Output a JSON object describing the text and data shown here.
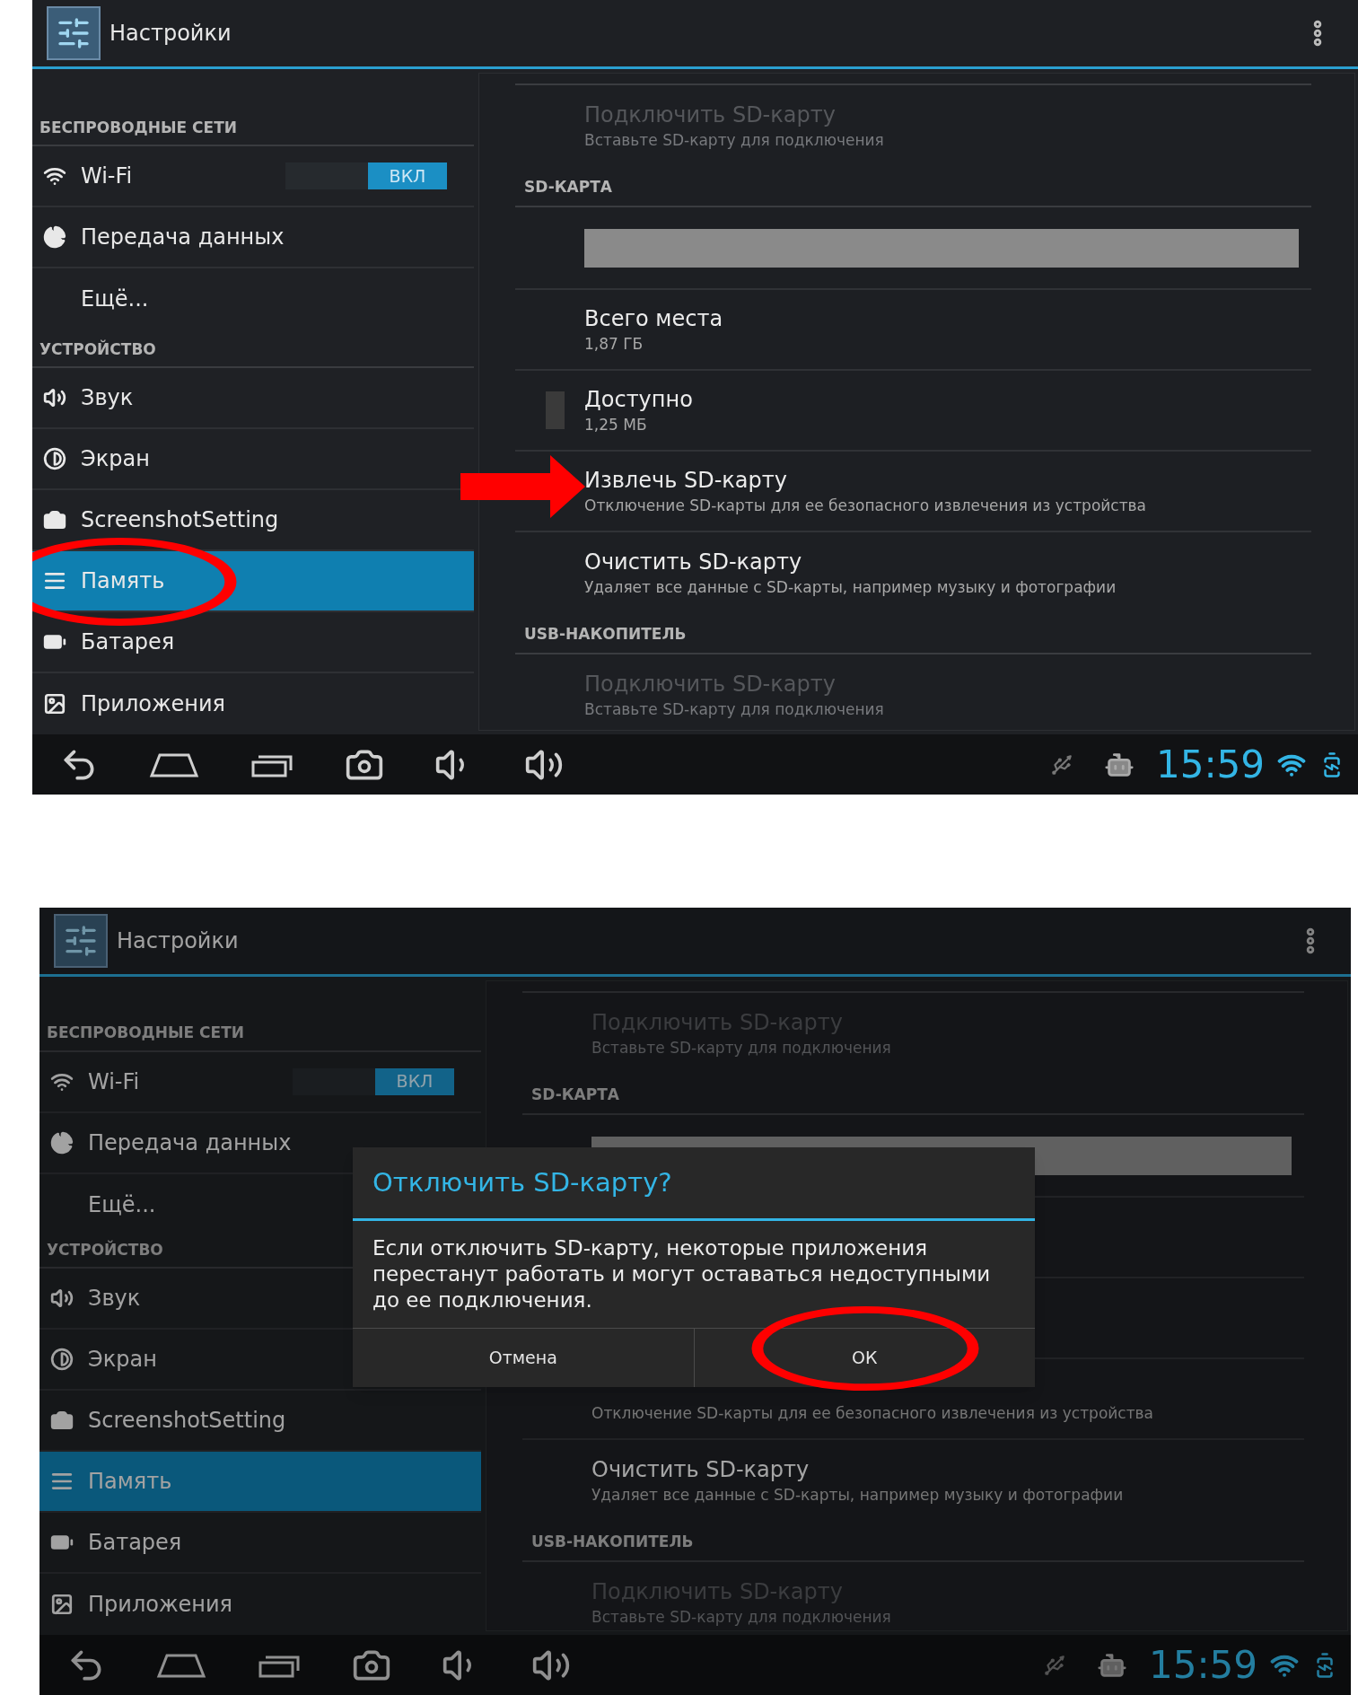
{
  "screens": [
    {
      "title": "Настройки",
      "sidebar": [
        {
          "kind": "header",
          "label": "БЕСПРОВОДНЫЕ СЕТИ"
        },
        {
          "kind": "item",
          "label": "Wi-Fi",
          "selected": false,
          "toggle": {
            "label": "ВКЛ",
            "on": true
          }
        },
        {
          "kind": "item",
          "label": "Передача данных",
          "selected": false
        },
        {
          "kind": "item",
          "label": "Ещё...",
          "selected": false
        },
        {
          "kind": "header",
          "label": "УСТРОЙСТВО"
        },
        {
          "kind": "item",
          "label": "Звук",
          "selected": false
        },
        {
          "kind": "item",
          "label": "Экран",
          "selected": false
        },
        {
          "kind": "item",
          "label": "ScreenshotSetting",
          "selected": false
        },
        {
          "kind": "item",
          "label": "Память",
          "selected": true,
          "circled": true
        },
        {
          "kind": "item",
          "label": "Батарея",
          "selected": false
        },
        {
          "kind": "item",
          "label": "Приложения",
          "selected": false
        }
      ],
      "content": [
        {
          "kind": "item",
          "title": "Подключить SD-карту",
          "subtitle": "Вставьте SD-карту для подключения",
          "disabled": true
        },
        {
          "kind": "header",
          "label": "SD-КАРТА"
        },
        {
          "kind": "bar"
        },
        {
          "kind": "item",
          "title": "Всего места",
          "subtitle": "1,87 ГБ",
          "disabled": false
        },
        {
          "kind": "item",
          "title": "Доступно",
          "subtitle": "1,25 МБ",
          "disabled": false,
          "swatch": true
        },
        {
          "kind": "item",
          "title": "Извлечь SD-карту",
          "subtitle": "Отключение SD-карты для ее безопасного извлечения из устройства",
          "disabled": false,
          "arrow": true
        },
        {
          "kind": "item",
          "title": "Очистить SD-карту",
          "subtitle": "Удаляет все данные с SD-карты, например музыку и фотографии",
          "disabled": false
        },
        {
          "kind": "header",
          "label": "USB-НАКОПИТЕЛЬ"
        },
        {
          "kind": "item",
          "title": "Подключить SD-карту",
          "subtitle": "Вставьте SD-карту для подключения",
          "disabled": true
        }
      ],
      "clock": "15:59"
    },
    {
      "title": "Настройки",
      "sidebar": [
        {
          "kind": "header",
          "label": "БЕСПРОВОДНЫЕ СЕТИ"
        },
        {
          "kind": "item",
          "label": "Wi-Fi",
          "selected": false,
          "toggle": {
            "label": "ВКЛ",
            "on": true
          }
        },
        {
          "kind": "item",
          "label": "Передача данных",
          "selected": false
        },
        {
          "kind": "item",
          "label": "Ещё...",
          "selected": false
        },
        {
          "kind": "header",
          "label": "УСТРОЙСТВО"
        },
        {
          "kind": "item",
          "label": "Звук",
          "selected": false
        },
        {
          "kind": "item",
          "label": "Экран",
          "selected": false
        },
        {
          "kind": "item",
          "label": "ScreenshotSetting",
          "selected": false
        },
        {
          "kind": "item",
          "label": "Память",
          "selected": true
        },
        {
          "kind": "item",
          "label": "Батарея",
          "selected": false
        },
        {
          "kind": "item",
          "label": "Приложения",
          "selected": false
        }
      ],
      "content": [
        {
          "kind": "item",
          "title": "Подключить SD-карту",
          "subtitle": "Вставьте SD-карту для подключения",
          "disabled": true
        },
        {
          "kind": "header",
          "label": "SD-КАРТА"
        },
        {
          "kind": "bar"
        },
        {
          "kind": "blank"
        },
        {
          "kind": "blank"
        },
        {
          "kind": "item",
          "subtitle": "Отключение SD-карты для ее безопасного извлечения из устройства",
          "disabled": false
        },
        {
          "kind": "item",
          "title": "Очистить SD-карту",
          "subtitle": "Удаляет все данные с SD-карты, например музыку и фотографии",
          "disabled": false
        },
        {
          "kind": "header",
          "label": "USB-НАКОПИТЕЛЬ"
        },
        {
          "kind": "item",
          "title": "Подключить SD-карту",
          "subtitle": "Вставьте SD-карту для подключения",
          "disabled": true
        }
      ],
      "clock": "15:59",
      "dialog": {
        "title": "Отключить SD-карту?",
        "message": "Если отключить SD-карту, некоторые приложения перестанут работать и могут оставаться недоступными до ее подключения.",
        "buttons": [
          {
            "label": "Отмена",
            "circled": false
          },
          {
            "label": "ОК",
            "circled": true
          }
        ]
      }
    }
  ]
}
